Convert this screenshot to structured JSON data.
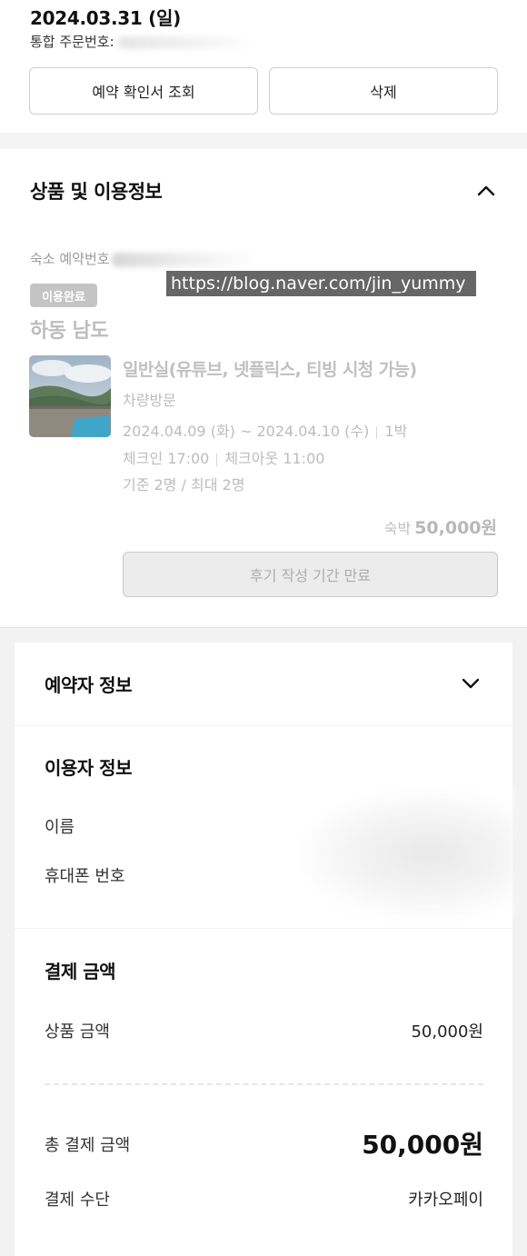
{
  "order": {
    "date": "2024.03.31 (일)",
    "order_number_label": "통합 주문번호:",
    "view_confirmation_label": "예약 확인서 조회",
    "delete_label": "삭제"
  },
  "product_section": {
    "title": "상품 및 이용정보",
    "stay_reservation_label": "숙소 예약번호",
    "watermark": "https://blog.naver.com/jin_yummy",
    "status_badge": "이용완료",
    "hotel_name": "하동 남도",
    "room_name": "일반실(유튜브, 넷플릭스, 티빙 시청 가능)",
    "visit_type": "차량방문",
    "dates": "2024.04.09 (화) ~ 2024.04.10 (수)",
    "nights": "1박",
    "checkin": "체크인 17:00",
    "checkout": "체크아웃 11:00",
    "occupancy": "기준 2명 / 최대 2명",
    "price_label": "숙박",
    "price_value": "50,000원",
    "review_button": "후기 작성 기간 만료"
  },
  "booker_section": {
    "title": "예약자 정보"
  },
  "user_section": {
    "title": "이용자 정보",
    "name_label": "이름",
    "phone_label": "휴대폰 번호"
  },
  "payment_section": {
    "title": "결제 금액",
    "product_amount_label": "상품 금액",
    "product_amount_value": "50,000원",
    "total_label": "총 결제 금액",
    "total_value": "50,000원",
    "method_label": "결제 수단",
    "method_value": "카카오페이"
  }
}
